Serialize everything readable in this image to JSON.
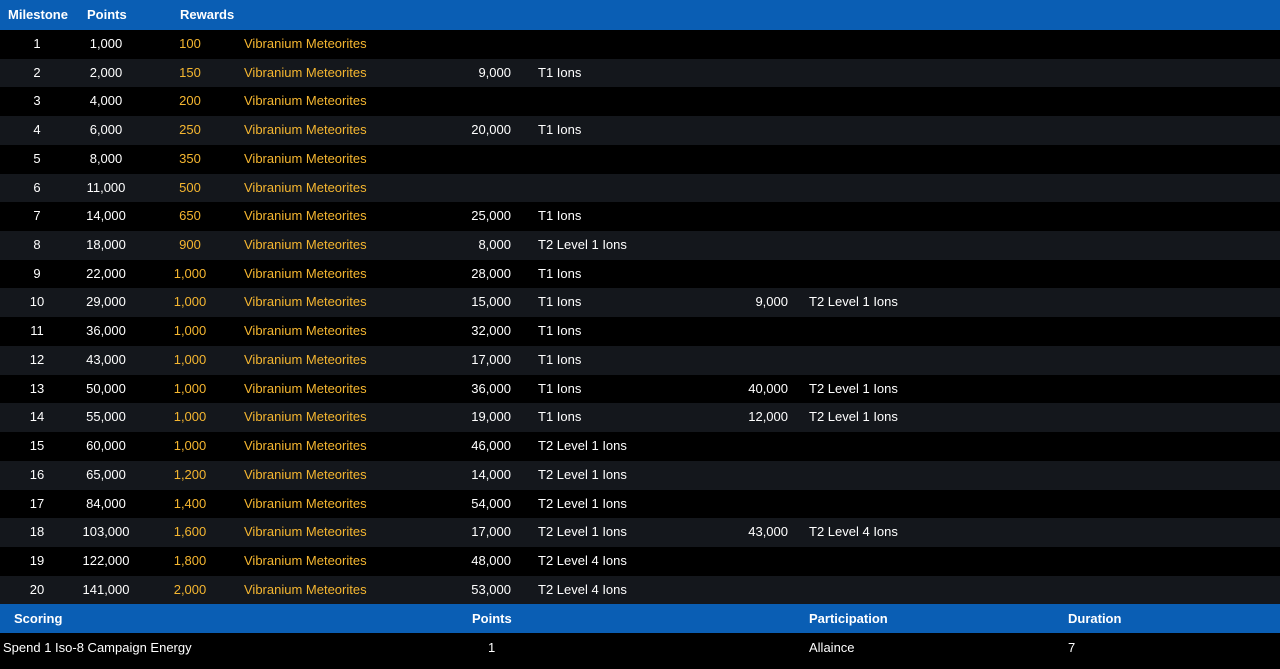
{
  "milestones_table": {
    "headers": {
      "milestone": "Milestone",
      "points": "Points",
      "rewards": "Rewards"
    },
    "rows": [
      {
        "milestone": "1",
        "points": "1,000",
        "reward_amount": "100",
        "reward_name": "Vibranium Meteorites",
        "ion1_amount": "",
        "ion1_name": "",
        "ion2_amount": "",
        "ion2_name": ""
      },
      {
        "milestone": "2",
        "points": "2,000",
        "reward_amount": "150",
        "reward_name": "Vibranium Meteorites",
        "ion1_amount": "9,000",
        "ion1_name": "T1 Ions",
        "ion2_amount": "",
        "ion2_name": ""
      },
      {
        "milestone": "3",
        "points": "4,000",
        "reward_amount": "200",
        "reward_name": "Vibranium Meteorites",
        "ion1_amount": "",
        "ion1_name": "",
        "ion2_amount": "",
        "ion2_name": ""
      },
      {
        "milestone": "4",
        "points": "6,000",
        "reward_amount": "250",
        "reward_name": "Vibranium Meteorites",
        "ion1_amount": "20,000",
        "ion1_name": "T1 Ions",
        "ion2_amount": "",
        "ion2_name": ""
      },
      {
        "milestone": "5",
        "points": "8,000",
        "reward_amount": "350",
        "reward_name": "Vibranium Meteorites",
        "ion1_amount": "",
        "ion1_name": "",
        "ion2_amount": "",
        "ion2_name": ""
      },
      {
        "milestone": "6",
        "points": "11,000",
        "reward_amount": "500",
        "reward_name": "Vibranium Meteorites",
        "ion1_amount": "",
        "ion1_name": "",
        "ion2_amount": "",
        "ion2_name": ""
      },
      {
        "milestone": "7",
        "points": "14,000",
        "reward_amount": "650",
        "reward_name": "Vibranium Meteorites",
        "ion1_amount": "25,000",
        "ion1_name": "T1 Ions",
        "ion2_amount": "",
        "ion2_name": ""
      },
      {
        "milestone": "8",
        "points": "18,000",
        "reward_amount": "900",
        "reward_name": "Vibranium Meteorites",
        "ion1_amount": "8,000",
        "ion1_name": "T2 Level 1 Ions",
        "ion2_amount": "",
        "ion2_name": ""
      },
      {
        "milestone": "9",
        "points": "22,000",
        "reward_amount": "1,000",
        "reward_name": "Vibranium Meteorites",
        "ion1_amount": "28,000",
        "ion1_name": "T1 Ions",
        "ion2_amount": "",
        "ion2_name": ""
      },
      {
        "milestone": "10",
        "points": "29,000",
        "reward_amount": "1,000",
        "reward_name": "Vibranium Meteorites",
        "ion1_amount": "15,000",
        "ion1_name": "T1 Ions",
        "ion2_amount": "9,000",
        "ion2_name": "T2 Level 1 Ions"
      },
      {
        "milestone": "11",
        "points": "36,000",
        "reward_amount": "1,000",
        "reward_name": "Vibranium Meteorites",
        "ion1_amount": "32,000",
        "ion1_name": "T1 Ions",
        "ion2_amount": "",
        "ion2_name": ""
      },
      {
        "milestone": "12",
        "points": "43,000",
        "reward_amount": "1,000",
        "reward_name": "Vibranium Meteorites",
        "ion1_amount": "17,000",
        "ion1_name": "T1 Ions",
        "ion2_amount": "",
        "ion2_name": ""
      },
      {
        "milestone": "13",
        "points": "50,000",
        "reward_amount": "1,000",
        "reward_name": "Vibranium Meteorites",
        "ion1_amount": "36,000",
        "ion1_name": "T1 Ions",
        "ion2_amount": "40,000",
        "ion2_name": "T2 Level 1 Ions"
      },
      {
        "milestone": "14",
        "points": "55,000",
        "reward_amount": "1,000",
        "reward_name": "Vibranium Meteorites",
        "ion1_amount": "19,000",
        "ion1_name": "T1 Ions",
        "ion2_amount": "12,000",
        "ion2_name": "T2 Level 1 Ions"
      },
      {
        "milestone": "15",
        "points": "60,000",
        "reward_amount": "1,000",
        "reward_name": "Vibranium Meteorites",
        "ion1_amount": "46,000",
        "ion1_name": "T2 Level 1 Ions",
        "ion2_amount": "",
        "ion2_name": ""
      },
      {
        "milestone": "16",
        "points": "65,000",
        "reward_amount": "1,200",
        "reward_name": "Vibranium Meteorites",
        "ion1_amount": "14,000",
        "ion1_name": "T2 Level 1 Ions",
        "ion2_amount": "",
        "ion2_name": ""
      },
      {
        "milestone": "17",
        "points": "84,000",
        "reward_amount": "1,400",
        "reward_name": "Vibranium Meteorites",
        "ion1_amount": "54,000",
        "ion1_name": "T2 Level 1 Ions",
        "ion2_amount": "",
        "ion2_name": ""
      },
      {
        "milestone": "18",
        "points": "103,000",
        "reward_amount": "1,600",
        "reward_name": "Vibranium Meteorites",
        "ion1_amount": "17,000",
        "ion1_name": "T2 Level 1 Ions",
        "ion2_amount": "43,000",
        "ion2_name": "T2 Level 4 Ions"
      },
      {
        "milestone": "19",
        "points": "122,000",
        "reward_amount": "1,800",
        "reward_name": "Vibranium Meteorites",
        "ion1_amount": "48,000",
        "ion1_name": "T2 Level 4 Ions",
        "ion2_amount": "",
        "ion2_name": ""
      },
      {
        "milestone": "20",
        "points": "141,000",
        "reward_amount": "2,000",
        "reward_name": "Vibranium Meteorites",
        "ion1_amount": "53,000",
        "ion1_name": "T2 Level 4 Ions",
        "ion2_amount": "",
        "ion2_name": ""
      }
    ]
  },
  "scoring_table": {
    "headers": {
      "scoring": "Scoring",
      "points": "Points",
      "participation": "Participation",
      "duration": "Duration"
    },
    "rows": [
      {
        "scoring": "Spend 1 Iso-8 Campaign Energy",
        "points": "1",
        "participation": "Allaince",
        "duration": "7"
      }
    ]
  },
  "colors": {
    "header_bg": "#0a5eb4",
    "row_odd_bg": "#000000",
    "row_even_bg": "#14171c",
    "reward_text": "#f5b630",
    "text": "#ffffff"
  }
}
